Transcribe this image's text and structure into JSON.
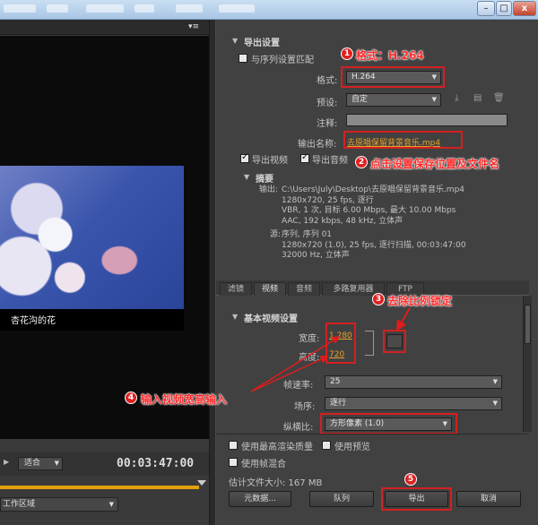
{
  "output_settings": {
    "title": "导出设置",
    "match_sequence_label": "与序列设置匹配",
    "format_label": "格式:",
    "format_value": "H.264",
    "preset_label": "预设:",
    "preset_value": "自定",
    "comment_label": "注释:",
    "output_name_label": "输出名称:",
    "output_name_value": "去原唱保留背景音乐.mp4",
    "export_video_label": "导出视频",
    "export_audio_label": "导出音频"
  },
  "summary": {
    "title": "摘要",
    "output_label": "输出:",
    "output_lines": "C:\\Users\\July\\Desktop\\去原唱保留背景音乐.mp4\n1280x720, 25 fps, 逐行\nVBR, 1 次, 目标 6.00 Mbps, 最大 10.00 Mbps\nAAC, 192 kbps, 48 kHz, 立体声",
    "source_label": "源:",
    "source_lines": "序列, 序列 01\n1280x720 (1.0), 25 fps, 逐行扫描, 00:03:47:00\n32000 Hz, 立体声"
  },
  "tabs": [
    "滤镜",
    "视频",
    "音频",
    "多路复用器",
    "FTP"
  ],
  "video": {
    "section_title": "基本视频设置",
    "width_label": "宽度:",
    "width_value": "1,280",
    "height_label": "高度:",
    "height_value": "720",
    "framerate_label": "帧速率:",
    "framerate_value": "25",
    "field_order_label": "场序:",
    "field_order_value": "逐行",
    "aspect_label": "纵横比:",
    "aspect_value": "方形像素 (1.0)"
  },
  "bottom": {
    "max_render_label": "使用最高渲染质量",
    "use_preview_label": "使用预览",
    "frame_blend_label": "使用帧混合",
    "file_size": "估计文件大小: 167 MB",
    "metadata_button": "元数据...",
    "queue_button": "队列",
    "export_button": "导出",
    "cancel_button": "取消"
  },
  "preview": {
    "caption": "杏花沟的花",
    "fit_value": "适合",
    "timecode": "00:03:47:00",
    "work_area": "工作区域"
  },
  "annotations": {
    "a1": {
      "badge": "1",
      "text": "格式：H.264"
    },
    "a2": {
      "badge": "2",
      "text": "点击设置保存位置及文件名"
    },
    "a3": {
      "badge": "3",
      "text": "去除比例锁定"
    },
    "a4": {
      "badge": "4",
      "text": "输入视频宽高输入"
    },
    "a5": {
      "badge": "5"
    }
  },
  "window": {
    "minimize": "–",
    "maximize": "□",
    "close": "x"
  },
  "colors": {
    "annotation_red": "#d42020",
    "link_orange": "#e7a12a",
    "timeline_orange": "#e1a00e"
  }
}
